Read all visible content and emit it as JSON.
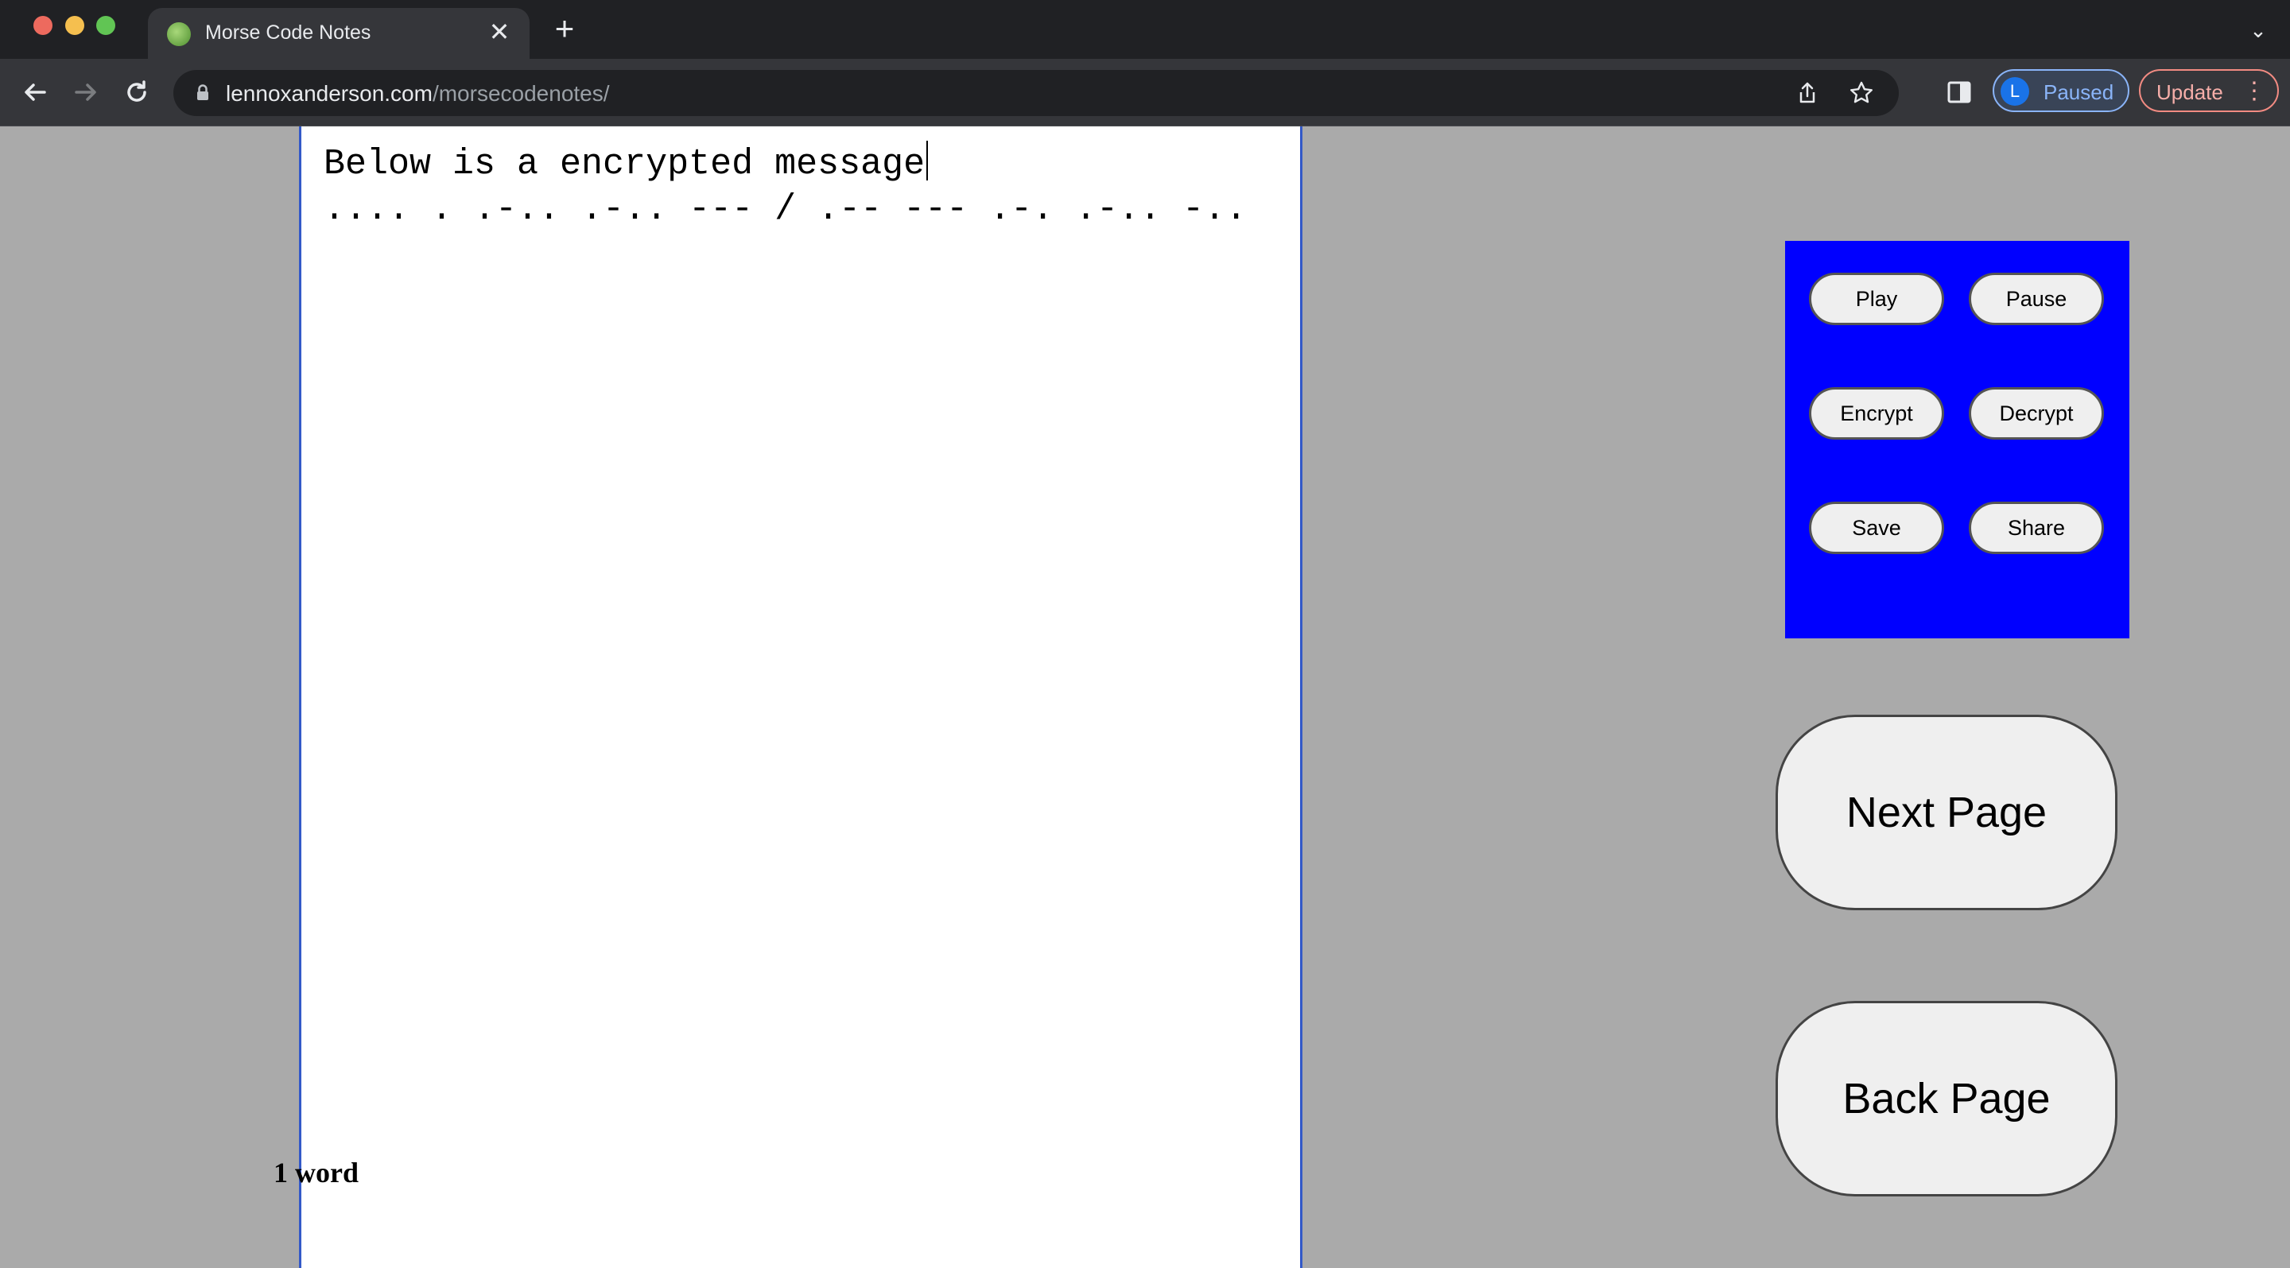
{
  "browser": {
    "tab_title": "Morse Code Notes",
    "tab_close": "✕",
    "new_tab": "+",
    "tab_list": "⌄",
    "url_host": "lennoxanderson.com",
    "url_path": "/morsecodenotes/",
    "profile_initial": "L",
    "profile_label": "Paused",
    "update_label": "Update",
    "menu_glyph": "⋮"
  },
  "note": {
    "plain_line": "Below is a encrypted message",
    "morse_line": ".... . .-.. .-.. --- / .-- --- .-. .-.. -..",
    "word_count": "1 word"
  },
  "controls": {
    "play": "Play",
    "pause": "Pause",
    "encrypt": "Encrypt",
    "decrypt": "Decrypt",
    "save": "Save",
    "share": "Share"
  },
  "pagination": {
    "next": "Next Page",
    "back": "Back Page"
  },
  "colors": {
    "page_background": "#aaaaaa",
    "controls_panel": "#0000ff",
    "paper_border": "#3359c8"
  }
}
